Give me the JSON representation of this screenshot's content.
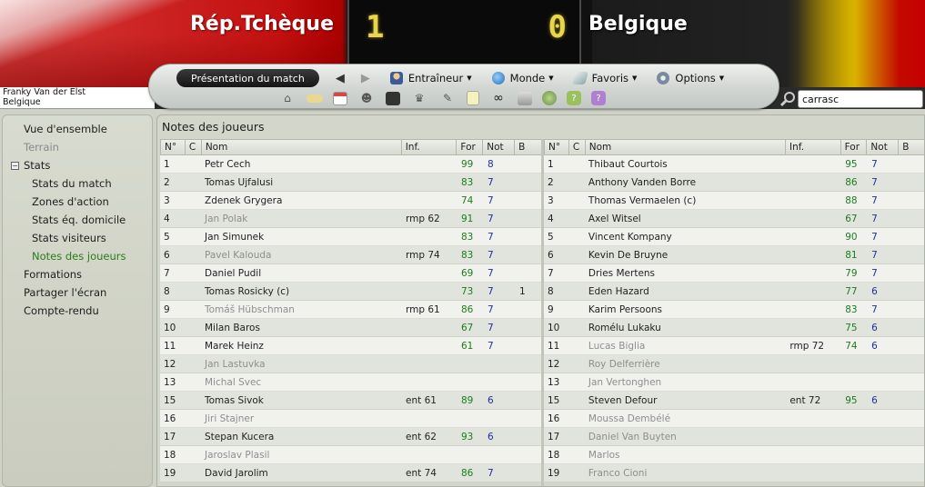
{
  "header": {
    "home_team": "Rép.Tchèque",
    "away_team": "Belgique",
    "home_score": "1",
    "away_score": "0"
  },
  "toolbar": {
    "presentation_label": "Présentation du match",
    "menus": [
      {
        "label": "Entraîneur",
        "icon": "coach-icon"
      },
      {
        "label": "Monde",
        "icon": "globe-icon"
      },
      {
        "label": "Favoris",
        "icon": "bookmark-icon"
      },
      {
        "label": "Options",
        "icon": "gear-icon"
      }
    ],
    "icons": [
      "home-icon",
      "money-icon",
      "calendar-icon",
      "people-icon",
      "board-icon",
      "trophy-icon",
      "scout-icon",
      "notes-icon",
      "binoculars-icon",
      "report-icon",
      "world-icon",
      "help-icon",
      "question-icon"
    ]
  },
  "manager": {
    "name": "Franky Van der Elst",
    "team": "Belgique"
  },
  "search": {
    "value": "carrasc"
  },
  "sidebar": {
    "overview": "Vue d'ensemble",
    "terrain": "Terrain",
    "stats": "Stats",
    "stats_match": "Stats du match",
    "zones": "Zones d'action",
    "stats_home": "Stats éq. domicile",
    "stats_away": "Stats visiteurs",
    "player_notes": "Notes des joueurs",
    "formations": "Formations",
    "split": "Partager l'écran",
    "report": "Compte-rendu"
  },
  "main": {
    "title": "Notes des joueurs",
    "columns": {
      "no": "N°",
      "c": "C",
      "nom": "Nom",
      "inf": "Inf.",
      "for": "For",
      "not": "Not",
      "b": "B"
    },
    "home_players": [
      {
        "no": "1",
        "c": "star",
        "nom": "Petr Cech",
        "inf": "",
        "for": "99",
        "not": "8",
        "b": "",
        "sub": false
      },
      {
        "no": "2",
        "c": "",
        "nom": "Tomas Ujfalusi",
        "inf": "",
        "for": "83",
        "not": "7",
        "b": "",
        "sub": false
      },
      {
        "no": "3",
        "c": "",
        "nom": "Zdenek Grygera",
        "inf": "",
        "for": "74",
        "not": "7",
        "b": "",
        "sub": false
      },
      {
        "no": "4",
        "c": "",
        "nom": "Jan Polak",
        "inf": "rmp 62",
        "for": "91",
        "not": "7",
        "b": "",
        "sub": true
      },
      {
        "no": "5",
        "c": "",
        "nom": "Jan Simunek",
        "inf": "",
        "for": "83",
        "not": "7",
        "b": "",
        "sub": false
      },
      {
        "no": "6",
        "c": "",
        "nom": "Pavel Kalouda",
        "inf": "rmp 74",
        "for": "83",
        "not": "7",
        "b": "",
        "sub": true
      },
      {
        "no": "7",
        "c": "",
        "nom": "Daniel Pudil",
        "inf": "",
        "for": "69",
        "not": "7",
        "b": "",
        "sub": false
      },
      {
        "no": "8",
        "c": "",
        "nom": "Tomas Rosicky (c)",
        "inf": "",
        "for": "73",
        "not": "7",
        "b": "1",
        "sub": false
      },
      {
        "no": "9",
        "c": "",
        "nom": "Tomáš Hübschman",
        "inf": "rmp 61",
        "for": "86",
        "not": "7",
        "b": "",
        "sub": true
      },
      {
        "no": "10",
        "c": "",
        "nom": "Milan Baros",
        "inf": "",
        "for": "67",
        "not": "7",
        "b": "",
        "sub": false
      },
      {
        "no": "11",
        "c": "",
        "nom": "Marek Heinz",
        "inf": "",
        "for": "61",
        "not": "7",
        "b": "",
        "sub": false
      },
      {
        "no": "12",
        "c": "",
        "nom": "Jan Lastuvka",
        "inf": "",
        "for": "",
        "not": "",
        "b": "",
        "sub": true
      },
      {
        "no": "13",
        "c": "",
        "nom": "Michal Svec",
        "inf": "",
        "for": "",
        "not": "",
        "b": "",
        "sub": true
      },
      {
        "no": "15",
        "c": "",
        "nom": "Tomas Sivok",
        "inf": "ent 61",
        "for": "89",
        "not": "6",
        "b": "",
        "sub": false
      },
      {
        "no": "16",
        "c": "",
        "nom": "Jiri Stajner",
        "inf": "",
        "for": "",
        "not": "",
        "b": "",
        "sub": true
      },
      {
        "no": "17",
        "c": "",
        "nom": "Stepan Kucera",
        "inf": "ent 62",
        "for": "93",
        "not": "6",
        "b": "",
        "sub": false
      },
      {
        "no": "18",
        "c": "",
        "nom": "Jaroslav Plasil",
        "inf": "",
        "for": "",
        "not": "",
        "b": "",
        "sub": true
      },
      {
        "no": "19",
        "c": "",
        "nom": "David Jarolim",
        "inf": "ent 74",
        "for": "86",
        "not": "7",
        "b": "",
        "sub": false
      }
    ],
    "away_players": [
      {
        "no": "1",
        "c": "",
        "nom": "Thibaut Courtois",
        "inf": "",
        "for": "95",
        "not": "7",
        "b": "",
        "sub": false
      },
      {
        "no": "2",
        "c": "",
        "nom": "Anthony Vanden Borre",
        "inf": "",
        "for": "86",
        "not": "7",
        "b": "",
        "sub": false
      },
      {
        "no": "3",
        "c": "",
        "nom": "Thomas Vermaelen (c)",
        "inf": "",
        "for": "88",
        "not": "7",
        "b": "",
        "sub": false
      },
      {
        "no": "4",
        "c": "",
        "nom": "Axel Witsel",
        "inf": "",
        "for": "67",
        "not": "7",
        "b": "",
        "sub": false
      },
      {
        "no": "5",
        "c": "",
        "nom": "Vincent Kompany",
        "inf": "",
        "for": "90",
        "not": "7",
        "b": "",
        "sub": false
      },
      {
        "no": "6",
        "c": "",
        "nom": "Kevin De Bruyne",
        "inf": "",
        "for": "81",
        "not": "7",
        "b": "",
        "sub": false
      },
      {
        "no": "7",
        "c": "",
        "nom": "Dries Mertens",
        "inf": "",
        "for": "79",
        "not": "7",
        "b": "",
        "sub": false
      },
      {
        "no": "8",
        "c": "",
        "nom": "Eden Hazard",
        "inf": "",
        "for": "77",
        "not": "6",
        "b": "",
        "sub": false
      },
      {
        "no": "9",
        "c": "",
        "nom": "Karim Persoons",
        "inf": "",
        "for": "83",
        "not": "7",
        "b": "",
        "sub": false
      },
      {
        "no": "10",
        "c": "yellow",
        "nom": "Romélu Lukaku",
        "inf": "",
        "for": "75",
        "not": "6",
        "b": "",
        "sub": false
      },
      {
        "no": "11",
        "c": "",
        "nom": "Lucas Biglia",
        "inf": "rmp 72",
        "for": "74",
        "not": "6",
        "b": "",
        "sub": true
      },
      {
        "no": "12",
        "c": "",
        "nom": "Roy Delferrière",
        "inf": "",
        "for": "",
        "not": "",
        "b": "",
        "sub": true
      },
      {
        "no": "13",
        "c": "",
        "nom": "Jan Vertonghen",
        "inf": "",
        "for": "",
        "not": "",
        "b": "",
        "sub": true
      },
      {
        "no": "15",
        "c": "",
        "nom": "Steven Defour",
        "inf": "ent 72",
        "for": "95",
        "not": "6",
        "b": "",
        "sub": false
      },
      {
        "no": "16",
        "c": "",
        "nom": "Moussa Dembélé",
        "inf": "",
        "for": "",
        "not": "",
        "b": "",
        "sub": true
      },
      {
        "no": "17",
        "c": "",
        "nom": "Daniel Van Buyten",
        "inf": "",
        "for": "",
        "not": "",
        "b": "",
        "sub": true
      },
      {
        "no": "18",
        "c": "",
        "nom": "Marlos",
        "inf": "",
        "for": "",
        "not": "",
        "b": "",
        "sub": true
      },
      {
        "no": "19",
        "c": "",
        "nom": "Franco Cioni",
        "inf": "",
        "for": "",
        "not": "",
        "b": "",
        "sub": true
      }
    ]
  }
}
